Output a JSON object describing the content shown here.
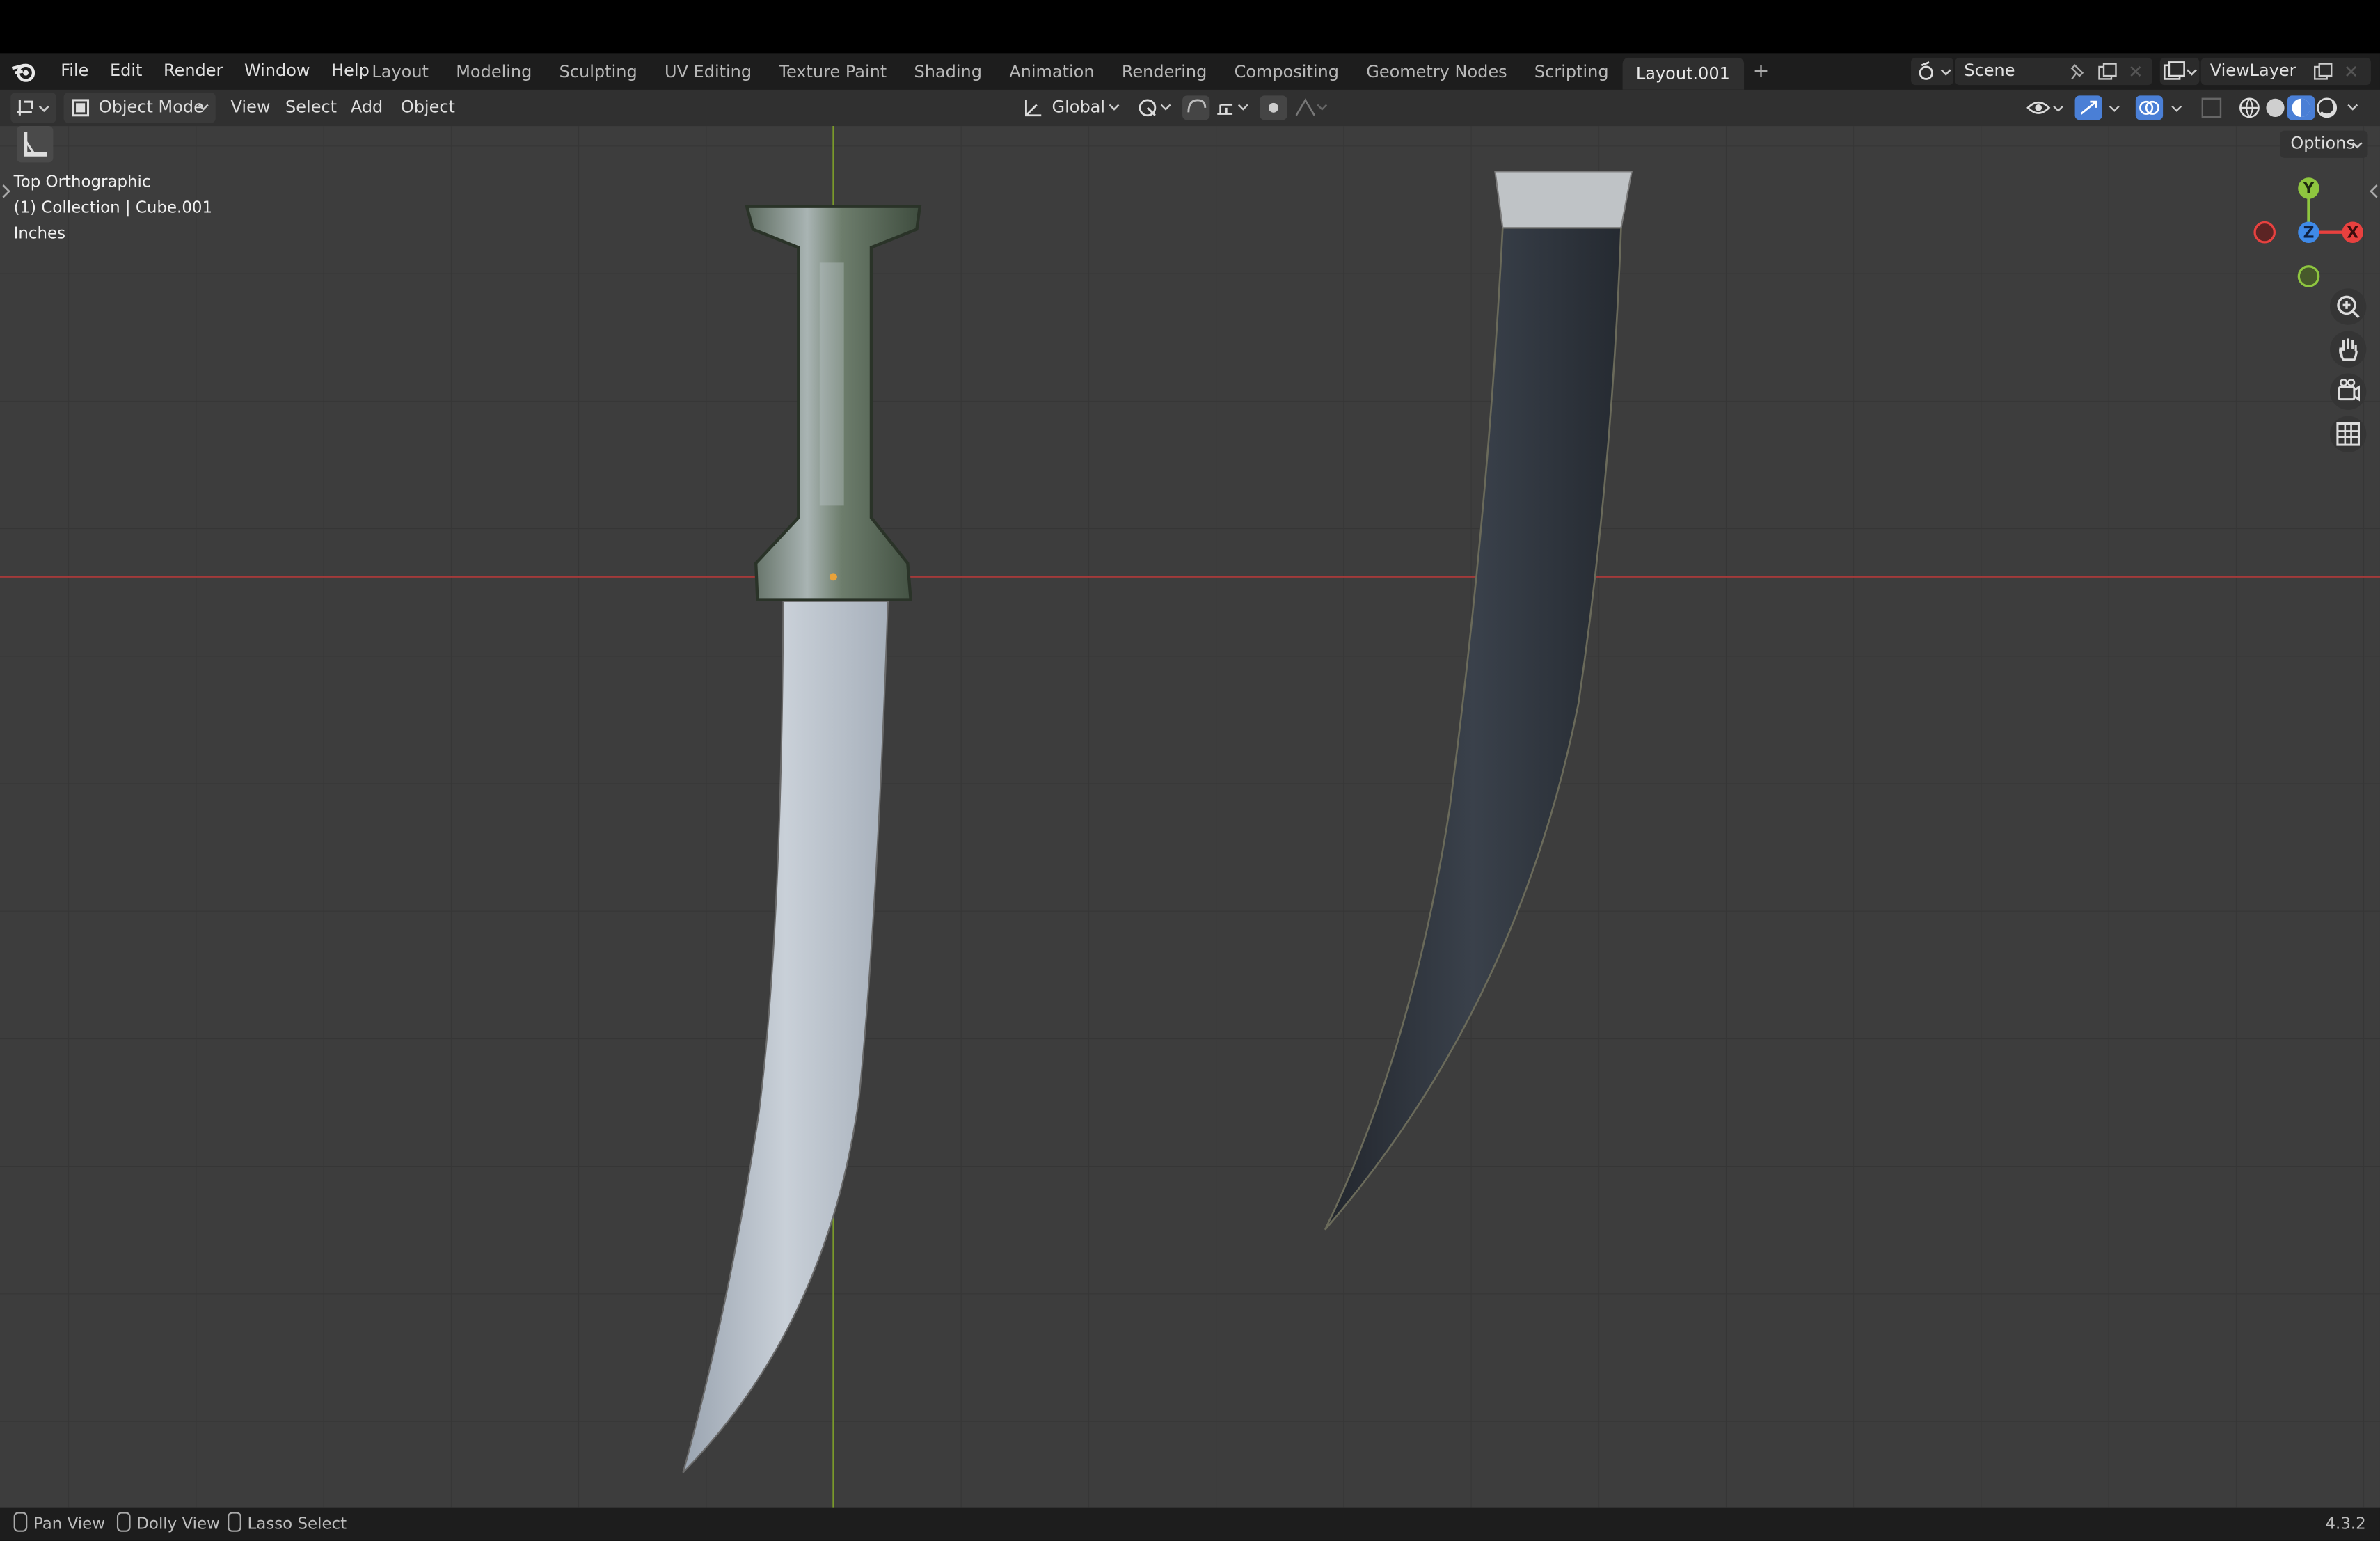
{
  "topbar": {
    "menu": [
      "File",
      "Edit",
      "Render",
      "Window",
      "Help"
    ],
    "workspaces": [
      "Layout",
      "Modeling",
      "Sculpting",
      "UV Editing",
      "Texture Paint",
      "Shading",
      "Animation",
      "Rendering",
      "Compositing",
      "Geometry Nodes",
      "Scripting",
      "Layout.001"
    ],
    "active_workspace": "Layout.001",
    "add_workspace": "+",
    "scene": "Scene",
    "view_layer": "ViewLayer"
  },
  "header": {
    "mode": "Object Mode",
    "menus": [
      "View",
      "Select",
      "Add",
      "Object"
    ],
    "orientation": "Global"
  },
  "viewport": {
    "view_name": "Top Orthographic",
    "collection": "(1) Collection | Cube.001",
    "units": "Inches",
    "options_label": "Options",
    "gizmo_axes": [
      "Y",
      "Z",
      "X"
    ]
  },
  "statusbar": {
    "items": [
      "Pan View",
      "Dolly View",
      "Lasso Select"
    ],
    "version": "4.3.2"
  },
  "colors": {
    "axis_x": "#e8413f",
    "axis_y": "#8ec63f",
    "axis_z": "#3f8ae8",
    "grid_bg": "#3d3d3d",
    "accent": "#4a7fd6"
  }
}
